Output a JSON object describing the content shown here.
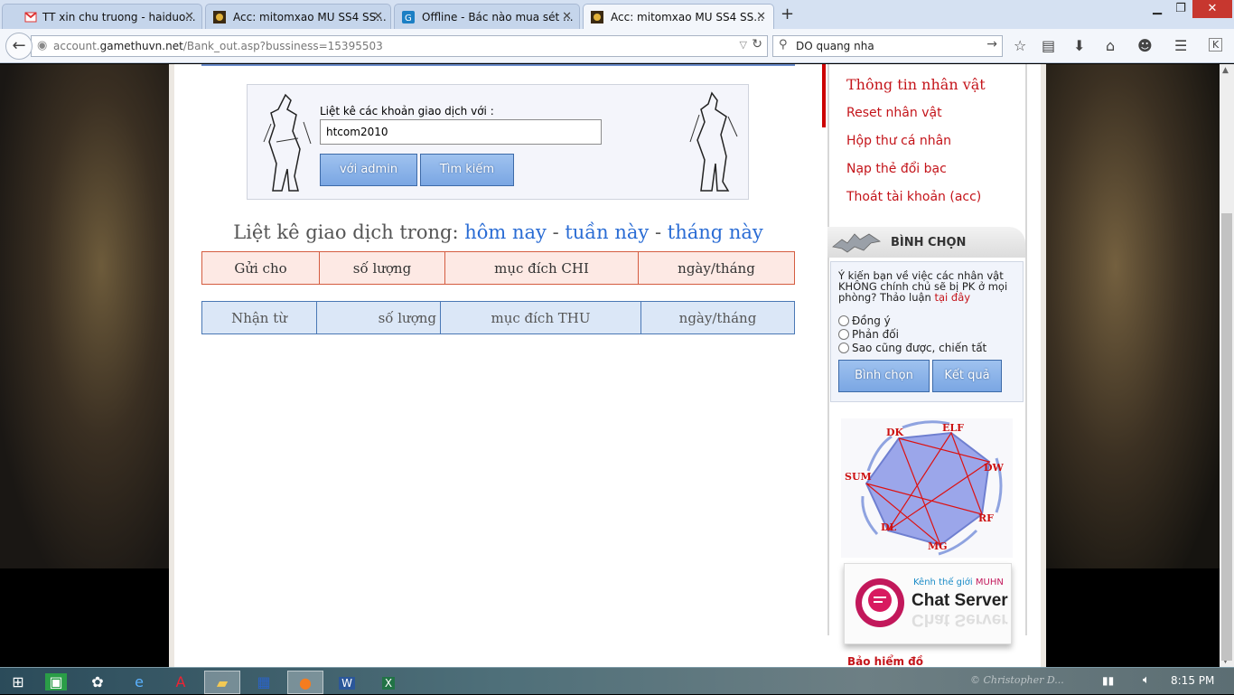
{
  "browser": {
    "tabs": [
      {
        "title": "TT xin chu truong - haiduo...",
        "icon": "gmail-icon"
      },
      {
        "title": "Acc: mitomxao MU SS4 SS...",
        "icon": "mu-game-icon"
      },
      {
        "title": "Offline - Bác nào mua sét ...",
        "icon": "g-site-icon"
      },
      {
        "title": "Acc: mitomxao MU SS4 SS...",
        "icon": "mu-game-icon"
      }
    ],
    "url_prefix": "account.",
    "url_domain": "gamethuvn.net",
    "url_path": "/Bank_out.asp?bussiness=15395503",
    "search_value": "DO quang nha"
  },
  "search_panel": {
    "label": "Liệt kê các khoản giao dịch với :",
    "input_value": "htcom2010",
    "btn_admin": "với admin",
    "btn_search": "Tìm kiếm"
  },
  "list_title": {
    "prefix": "Liệt kê giao dịch trong:",
    "today": "hôm nay",
    "sep1": " - ",
    "week": "tuần này",
    "sep2": " - ",
    "month": "tháng này"
  },
  "table_out": {
    "headers": [
      "Gửi cho",
      "số lượng",
      "mục đích CHI",
      "ngày/tháng"
    ]
  },
  "table_in": {
    "headers": [
      "Nhận từ",
      "số lượng",
      "mục đích THU",
      "ngày/tháng"
    ]
  },
  "menu": {
    "items": [
      "Thông tin nhân vật",
      "Reset nhân vật",
      "Hộp thư cá nhân",
      "Nạp thẻ đổi bạc",
      "Thoát tài khoản (acc)"
    ]
  },
  "vote": {
    "title": "BÌNH CHỌN",
    "question": "Ý kiến bạn về việc các nhân vật KHÔNG chính chủ sẽ bị PK ở mọi phòng? Thảo luận",
    "link": "tại đây",
    "options": [
      "Đồng ý",
      "Phản đối",
      "Sao cũng được, chiến tất"
    ],
    "btn_vote": "Bình chọn",
    "btn_result": "Kết quả"
  },
  "class_wheel": {
    "labels": [
      "DK",
      "ELF",
      "DW",
      "RF",
      "MG",
      "DL",
      "SUM"
    ]
  },
  "chat_server": {
    "subtitle_prefix": "Kênh thế giới",
    "subtitle_brand": "MUHN",
    "title": "Chat Server"
  },
  "insurance": "Bảo hiểm đồ",
  "taskbar": {
    "time": "8:15 PM",
    "watermark": "© Christopher D..."
  },
  "colors": {
    "accent_red": "#c4141a",
    "link_blue": "#2a6cd4",
    "button_blue": "#7aa6e3"
  }
}
